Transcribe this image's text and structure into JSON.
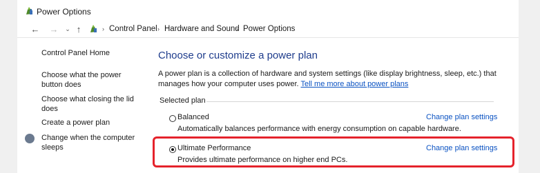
{
  "window": {
    "title": "Power Options",
    "app_icon": "power-options-icon"
  },
  "navigation": {
    "back_icon": "←",
    "forward_icon": "→",
    "recent_icon": "⌄",
    "up_icon": "↑",
    "breadcrumb_icon": "control-panel-icon",
    "separator": "›",
    "breadcrumbs": [
      "Control Panel",
      "Hardware and Sound",
      "Power Options"
    ]
  },
  "sidebar": {
    "items": [
      {
        "label": "Control Panel Home"
      },
      {
        "label_lines": [
          "Choose what the power",
          "button does"
        ]
      },
      {
        "label_lines": [
          "Choose what closing the lid",
          "does"
        ]
      },
      {
        "label": "Create a power plan"
      },
      {
        "label_lines": [
          "Change when the computer",
          "sleeps"
        ],
        "icon": "shield-moon-icon"
      }
    ]
  },
  "main": {
    "heading": "Choose or customize a power plan",
    "description_line1": "A power plan is a collection of hardware and system settings (like display brightness, sleep, etc.) that",
    "description_line2": "manages how your computer uses power.",
    "description_link": "Tell me more about power plans",
    "group_label": "Selected plan",
    "plans": [
      {
        "name": "Balanced",
        "description": "Automatically balances performance with energy consumption on capable hardware.",
        "link": "Change plan settings",
        "selected": false
      },
      {
        "name": "Ultimate Performance",
        "description": "Provides ultimate performance on higher end PCs.",
        "link": "Change plan settings",
        "selected": true
      }
    ]
  },
  "colors": {
    "heading": "#1e3c8c",
    "link": "#0a52c2",
    "highlight": "#e5222b"
  }
}
